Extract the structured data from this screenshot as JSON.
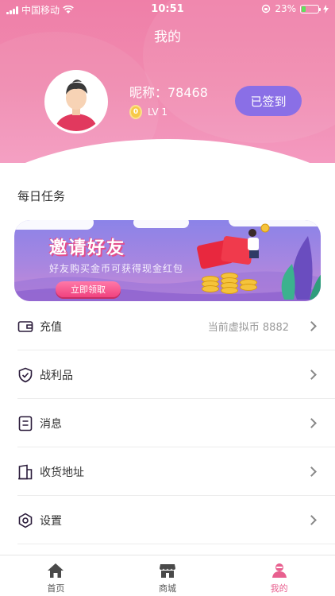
{
  "status_bar": {
    "carrier": "中国移动",
    "time": "10:51",
    "battery_percent": "23%"
  },
  "header": {
    "title": "我的",
    "nickname": "昵称：78468",
    "level": "LV 1",
    "level_badge": "0",
    "signin_label": "已签到"
  },
  "daily_tasks": {
    "title": "每日任务",
    "banner": {
      "title": "邀请好友",
      "subtitle": "好友购买金币可获得现金红包",
      "button": "立即领取"
    }
  },
  "menu": [
    {
      "label": "充值",
      "value": "当前虚拟币 8882",
      "icon": "wallet-icon"
    },
    {
      "label": "战利品",
      "value": "",
      "icon": "shield-check-icon"
    },
    {
      "label": "消息",
      "value": "",
      "icon": "message-icon"
    },
    {
      "label": "收货地址",
      "value": "",
      "icon": "building-icon"
    },
    {
      "label": "设置",
      "value": "",
      "icon": "settings-icon"
    }
  ],
  "tabbar": [
    {
      "label": "首页",
      "icon": "home-icon",
      "active": false
    },
    {
      "label": "商城",
      "icon": "store-icon",
      "active": false
    },
    {
      "label": "我的",
      "icon": "user-icon",
      "active": true
    }
  ],
  "colors": {
    "header_pink": "#ef7fa8",
    "signin_purple": "#8a6fe6",
    "active_tab": "#e8608f"
  }
}
